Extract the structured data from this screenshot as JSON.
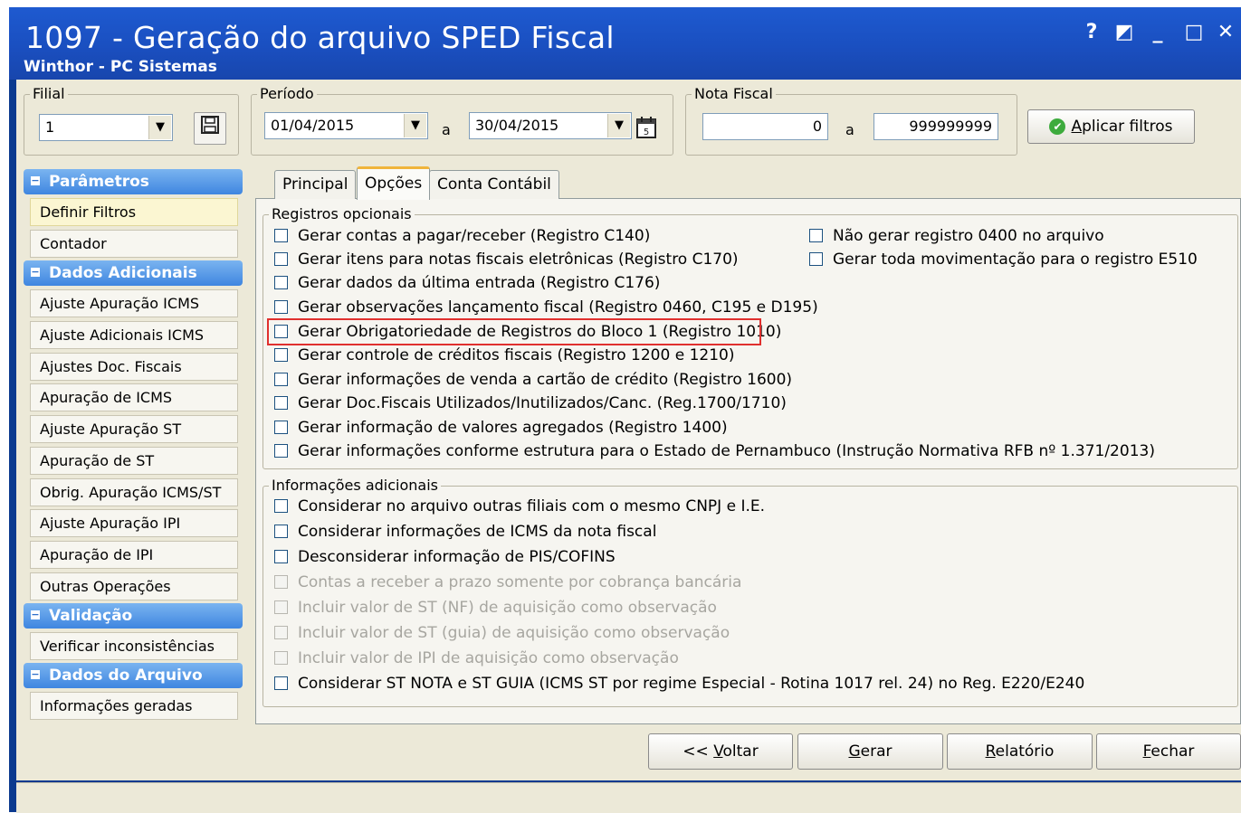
{
  "window": {
    "title": "1097 - Geração do arquivo SPED Fiscal",
    "subtitle": "Winthor - PC Sistemas",
    "controls": [
      "?",
      "◩",
      "_",
      "□",
      "✕"
    ]
  },
  "filters": {
    "filial": {
      "label": "Filial",
      "value": "1"
    },
    "periodo": {
      "label": "Período",
      "from": "01/04/2015",
      "sep": "a",
      "to": "30/04/2015"
    },
    "nota_fiscal": {
      "label": "Nota Fiscal",
      "from": "0",
      "sep": "a",
      "to": "999999999"
    },
    "apply_button": {
      "prefix": "",
      "accel": "A",
      "rest": "plicar filtros"
    }
  },
  "sidebar": {
    "sections": [
      {
        "title": "Parâmetros",
        "items": [
          "Definir Filtros",
          "Contador"
        ]
      },
      {
        "title": "Dados Adicionais",
        "items": [
          "Ajuste Apuração ICMS",
          "Ajuste Adicionais ICMS",
          "Ajustes Doc. Fiscais",
          "Apuração de ICMS",
          "Ajuste Apuração ST",
          "Apuração de ST",
          "Obrig. Apuração ICMS/ST",
          "Ajuste Apuração IPI",
          "Apuração de IPI",
          "Outras Operações"
        ]
      },
      {
        "title": "Validação",
        "items": [
          "Verificar inconsistências"
        ]
      },
      {
        "title": "Dados do Arquivo",
        "items": [
          "Informações geradas"
        ]
      }
    ]
  },
  "tabs": [
    "Principal",
    "Opções",
    "Conta Contábil"
  ],
  "registros_opcionais": {
    "label": "Registros opcionais",
    "left": [
      "Gerar contas a pagar/receber (Registro C140)",
      "Gerar itens para notas fiscais eletrônicas (Registro C170)",
      "Gerar dados da última entrada (Registro C176)",
      "Gerar observações lançamento fiscal (Registro 0460, C195 e D195)",
      "Gerar Obrigatoriedade de Registros do Bloco 1 (Registro  1010)",
      "Gerar controle de créditos fiscais (Registro 1200 e 1210)",
      "Gerar informações de venda a cartão de crédito (Registro 1600)",
      "Gerar Doc.Fiscais Utilizados/Inutilizados/Canc. (Reg.1700/1710)",
      "Gerar informação de valores agregados (Registro 1400)",
      "Gerar informações conforme estrutura para o Estado de Pernambuco (Instrução Normativa RFB nº 1.371/2013)"
    ],
    "right": [
      "Não gerar registro 0400 no arquivo",
      "Gerar toda movimentação para o registro E510"
    ]
  },
  "informacoes_adicionais": {
    "label": "Informações adicionais",
    "items": [
      {
        "text": "Considerar no arquivo outras filiais com o mesmo CNPJ e I.E.",
        "enabled": true
      },
      {
        "text": "Considerar informações de ICMS da nota fiscal",
        "enabled": true
      },
      {
        "text": "Desconsiderar informação de PIS/COFINS",
        "enabled": true
      },
      {
        "text": "Contas a receber a prazo somente por cobrança bancária",
        "enabled": false
      },
      {
        "text": "Incluir valor de ST (NF) de aquisição como observação",
        "enabled": false
      },
      {
        "text": "Incluir valor de ST (guia) de aquisição como observação",
        "enabled": false
      },
      {
        "text": "Incluir valor de IPI de aquisição como observação",
        "enabled": false
      },
      {
        "text": "Considerar ST NOTA e ST GUIA (ICMS ST por regime Especial - Rotina 1017 rel. 24) no Reg. E220/E240",
        "enabled": true
      }
    ]
  },
  "footer_buttons": [
    {
      "prefix": "<< ",
      "accel": "V",
      "rest": "oltar"
    },
    {
      "prefix": "",
      "accel": "G",
      "rest": "erar"
    },
    {
      "prefix": "",
      "accel": "R",
      "rest": "elatório"
    },
    {
      "prefix": "",
      "accel": "F",
      "rest": "echar"
    }
  ],
  "colors": {
    "titlebar": "#1a4fc0",
    "section_header": "#3f86e0",
    "highlight": "#e0302e",
    "active_tab": "#f0b53c"
  }
}
